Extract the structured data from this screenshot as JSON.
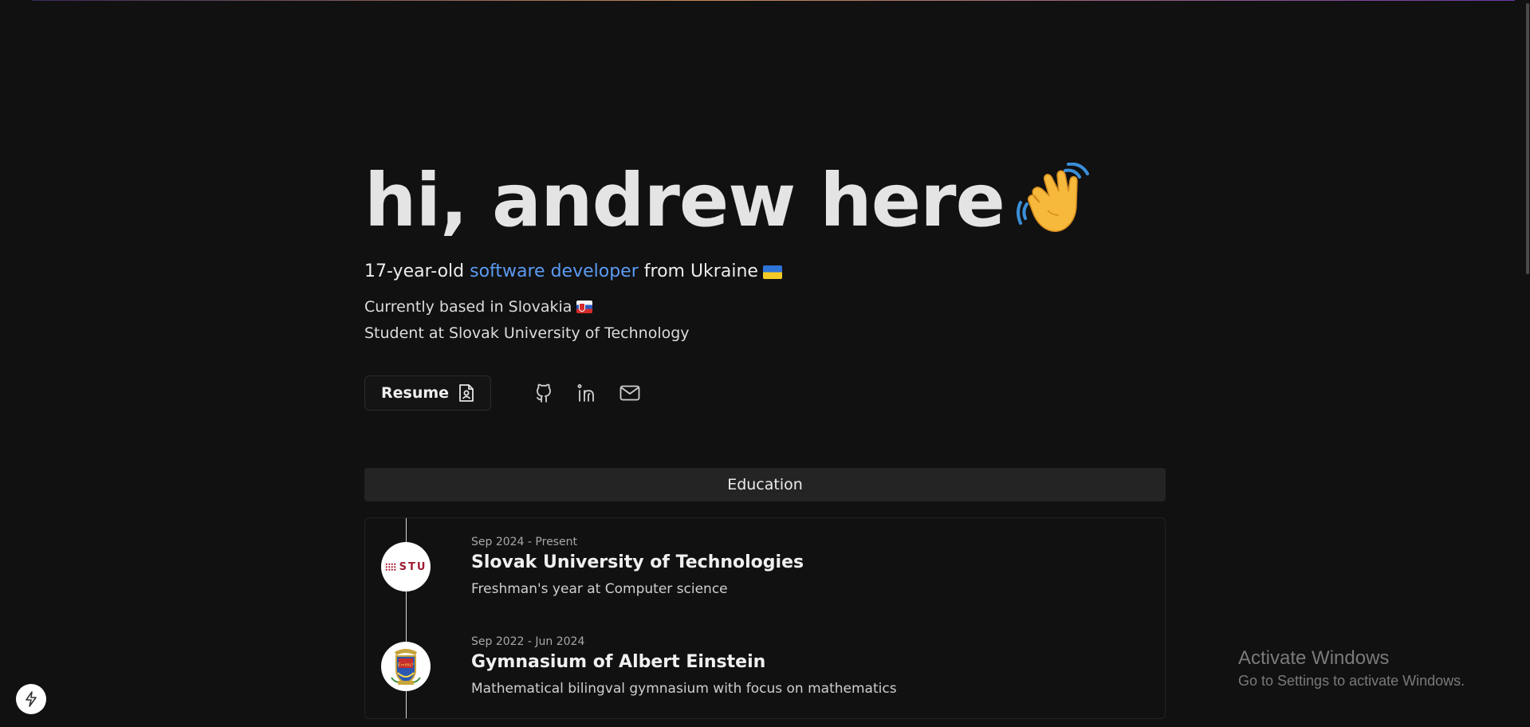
{
  "hero": {
    "title": "hi, andrew here",
    "emoji_icon": "waving-hand-icon"
  },
  "tagline": {
    "prefix": "17-year-old",
    "accent": "software developer",
    "suffix": "from Ukraine",
    "flag_icon": "ukraine-flag-icon",
    "accent_color": "#5b9bf2"
  },
  "info": {
    "location": "Currently based in Slovakia",
    "location_flag_icon": "slovakia-flag-icon",
    "school": "Student at Slovak University of Technology"
  },
  "actions": {
    "resume_label": "Resume",
    "resume_icon": "file-user-icon",
    "social": [
      {
        "name": "github",
        "icon": "github-icon"
      },
      {
        "name": "linkedin",
        "icon": "linkedin-icon"
      },
      {
        "name": "email",
        "icon": "mail-icon"
      }
    ]
  },
  "education": {
    "header": "Education",
    "entries": [
      {
        "date": "Sep 2024 - Present",
        "title": "Slovak University of Technologies",
        "description": "Freshman's year at Computer science",
        "logo_text": "STU"
      },
      {
        "date": "Sep 2022 - Jun 2024",
        "title": "Gymnasium of Albert Einstein",
        "description": "Mathematical bilingval gymnasium with focus on mathematics",
        "logo_icon": "school-crest-icon"
      }
    ]
  },
  "floating": {
    "bolt_icon": "bolt-icon"
  },
  "watermark": {
    "title": "Activate Windows",
    "subtitle": "Go to Settings to activate Windows."
  }
}
